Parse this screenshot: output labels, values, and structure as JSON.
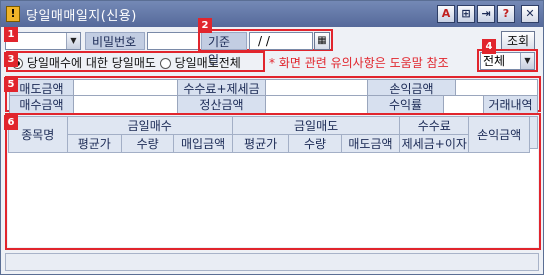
{
  "window": {
    "title": "당일매매일지(신용)",
    "app_icon": "app-icon",
    "title_buttons": [
      "A",
      "⊞",
      "⇥",
      "?",
      "✕"
    ]
  },
  "badges": [
    "1",
    "2",
    "3",
    "4",
    "5",
    "6"
  ],
  "filters": {
    "account_value": "",
    "password_label": "비밀번호",
    "date_label": "기준일",
    "date_value": "  /  /",
    "query_button": "조회"
  },
  "options": {
    "radio1_label": "당일매수에 대한 당일매도",
    "radio2_label": "당일매도전체",
    "notice": "* 화면 관련 유의사항은 도움말 참조",
    "scope_value": "전체"
  },
  "summary": {
    "r1": [
      "매도금액",
      "",
      "수수료+제세금",
      "",
      "손익금액",
      ""
    ],
    "r2": [
      "매수금액",
      "",
      "정산금액",
      "",
      "수익률",
      "",
      "거래내역"
    ]
  },
  "table": {
    "code_header": "종목명",
    "group_headers": [
      "금일매수",
      "금일매도",
      "수수료"
    ],
    "pnl_header": "손익금액",
    "sub_headers": [
      "평균가",
      "수량",
      "매입금액",
      "평균가",
      "수량",
      "매도금액",
      "제세금+이자"
    ]
  },
  "colors": {
    "accent_red": "#e1252d",
    "title_bar": "#5d72a3",
    "header_bg": "#d7e0ef"
  }
}
